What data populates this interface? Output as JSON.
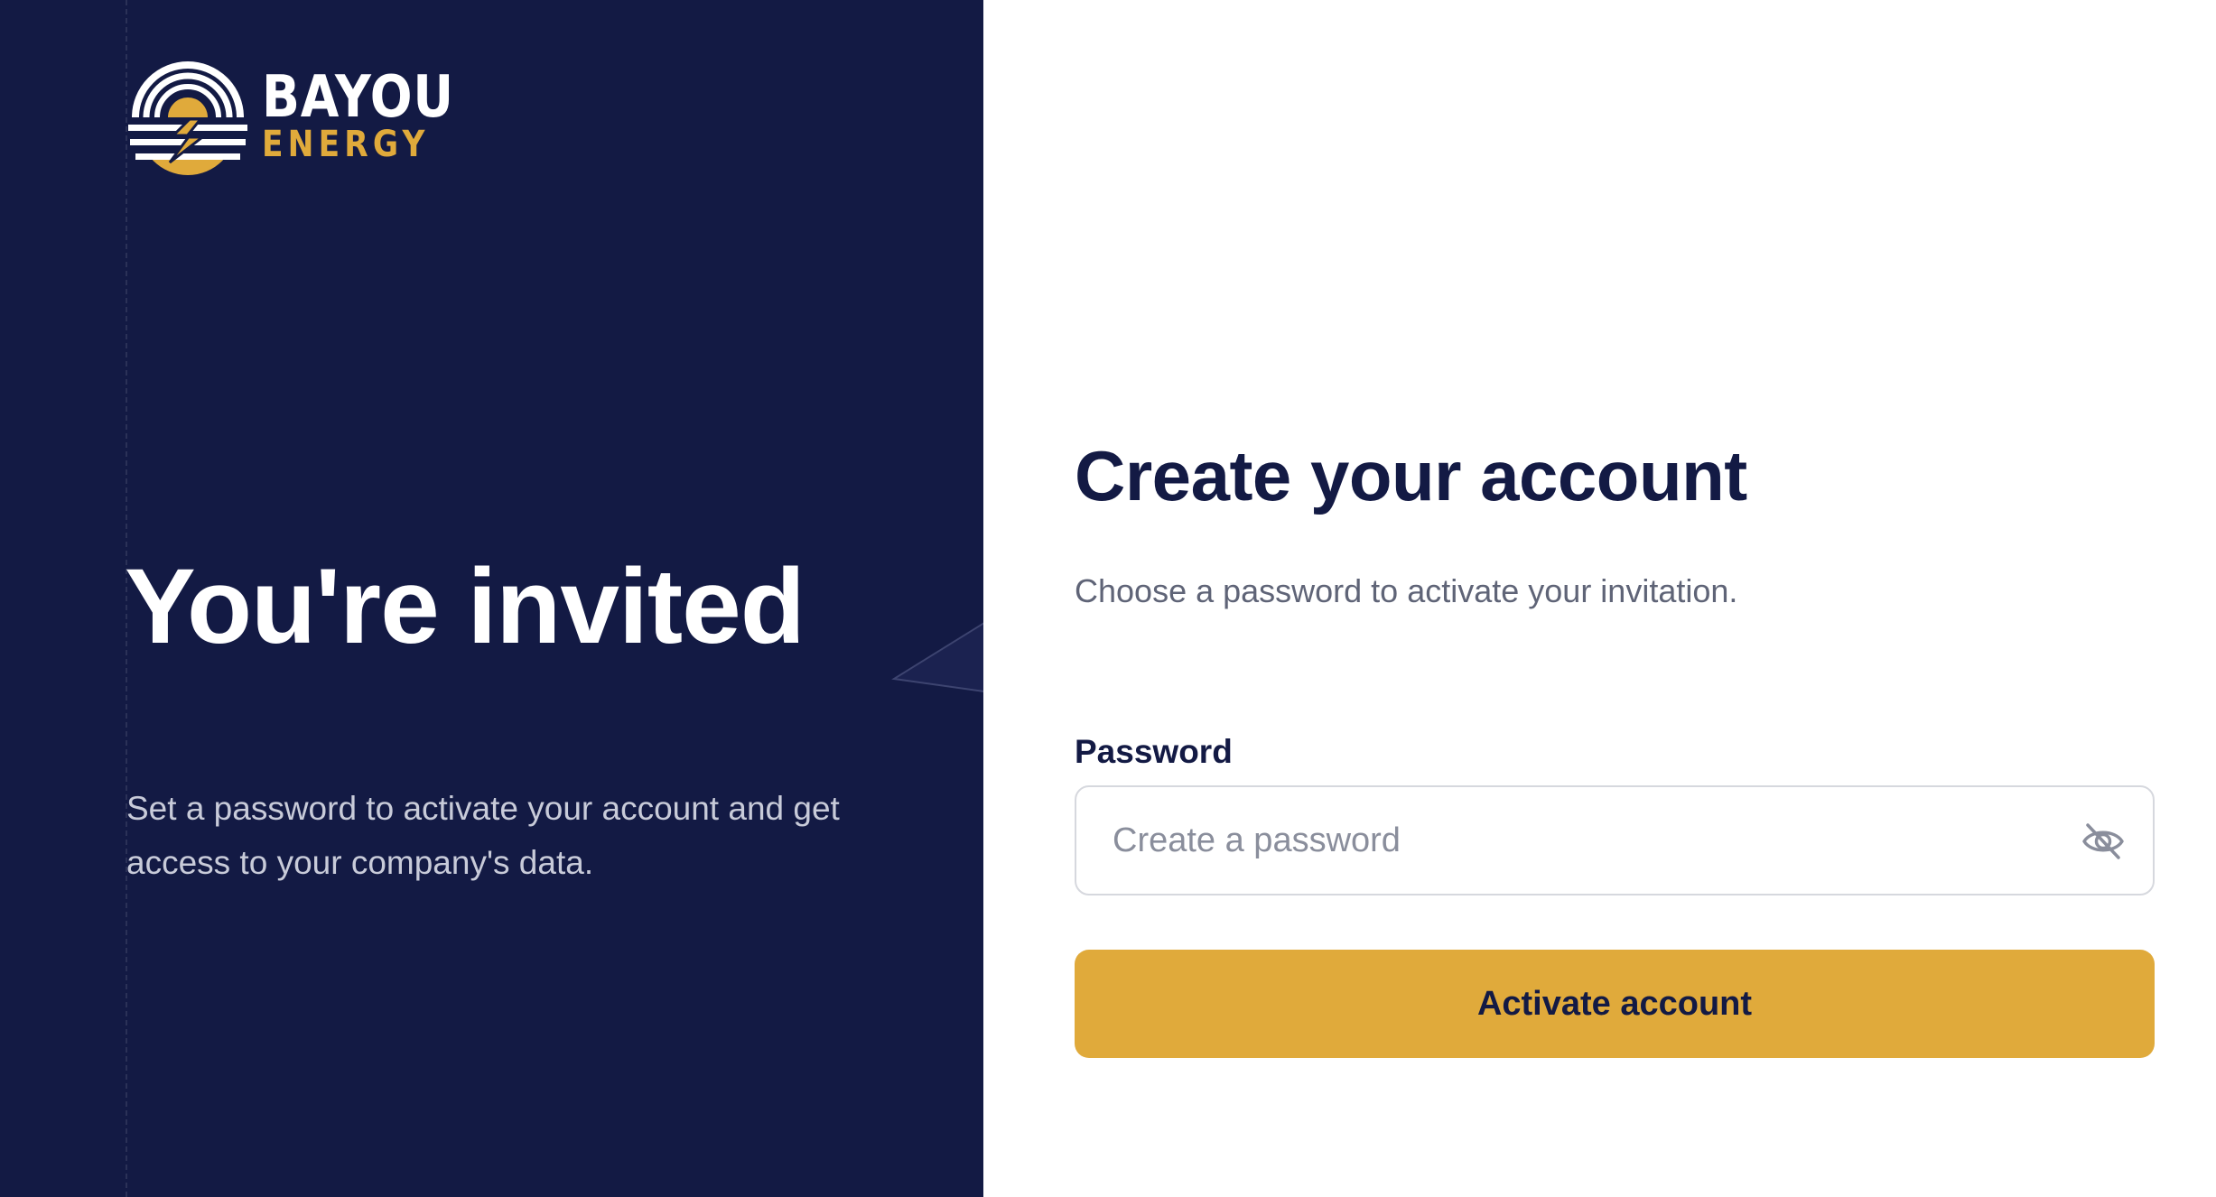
{
  "brand": {
    "name_top": "BAYOU",
    "name_bottom": "ENERGY",
    "logo_icon": "bayou-energy-logo",
    "primary_color": "#131a44",
    "accent_color": "#e0aa3b"
  },
  "hero": {
    "title": "You're invited",
    "subtitle": "Set a password to activate your account and get access to your company's data."
  },
  "form": {
    "title": "Create your account",
    "subtitle": "Choose a password to activate your invitation.",
    "password_label": "Password",
    "password_placeholder": "Create a password",
    "password_value": "",
    "visibility_icon": "eye-off-icon",
    "submit_label": "Activate account"
  }
}
